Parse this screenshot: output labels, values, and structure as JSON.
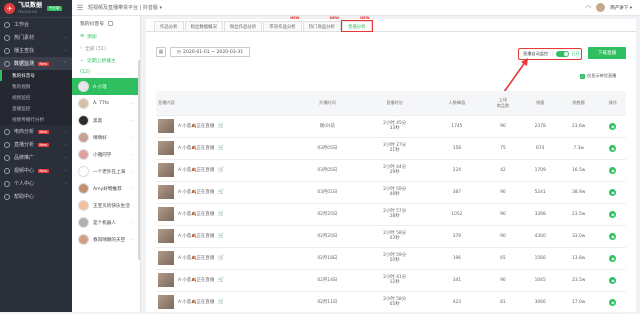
{
  "app": {
    "name": "飞瓜数据",
    "subtitle": "FEIGUA.CN",
    "badge": "专业版"
  },
  "sidebar": {
    "items": [
      {
        "label": "工作台",
        "icon": "home-icon"
      },
      {
        "label": "热门素材",
        "icon": "fire-icon",
        "arrow": "›"
      },
      {
        "label": "播主查找",
        "icon": "user-search-icon",
        "arrow": "›"
      },
      {
        "label": "数据监测",
        "icon": "monitor-icon",
        "arrow": "⌃",
        "badge": "New",
        "active": true
      },
      {
        "label": "电商分析",
        "icon": "cart-icon",
        "arrow": "›",
        "badge": "New"
      },
      {
        "label": "直播分析",
        "icon": "live-icon",
        "arrow": "›",
        "badge": "New"
      },
      {
        "label": "品牌推广",
        "icon": "brand-icon",
        "arrow": "›"
      },
      {
        "label": "视频中心",
        "icon": "video-icon",
        "arrow": "›",
        "badge": "New"
      },
      {
        "label": "个人中心",
        "icon": "person-icon",
        "arrow": "›"
      },
      {
        "label": "帮助中心",
        "icon": "help-icon"
      }
    ],
    "subitems": [
      {
        "label": "我的抖音号",
        "active": true
      },
      {
        "label": "我的视频"
      },
      {
        "label": "视频监控"
      },
      {
        "label": "直播监控"
      },
      {
        "label": "视频传播行分析"
      }
    ]
  },
  "topbar": {
    "crumb": "短视频及直播带货平台  |  抖音版 ▾",
    "collapse": "☰"
  },
  "list_panel": {
    "title": "我的抖音号",
    "add": "添加",
    "all": "全部 (31)",
    "group": "近期上新播主",
    "count": "(12)",
    "accounts": [
      {
        "name": "A·小莲",
        "color": "#e6e6e6",
        "active": true
      },
      {
        "name": "A. 77ts",
        "color": "#d8c0a8"
      },
      {
        "name": "黑黑",
        "color": "#2b2b2b"
      },
      {
        "name": "晴晴好",
        "color": "#c8a090"
      },
      {
        "name": "小雅同学",
        "color": "#e0a0a0"
      },
      {
        "name": "一个老外在上海",
        "color": "#ffffff"
      },
      {
        "name": "Amy好物推荐",
        "color": "#c09070"
      },
      {
        "name": "王宝贝的快乐生活",
        "color": "#f0c0a0"
      },
      {
        "name": "是个机器人",
        "color": "#b0b0b0"
      },
      {
        "name": "春风晴朗的天空",
        "color": "#d0a080"
      }
    ]
  },
  "tabs": [
    {
      "label": "作品分析"
    },
    {
      "label": "粉丝数据概况"
    },
    {
      "label": "粉丝作品分析"
    },
    {
      "label": "带货作品分析",
      "new": "NEW"
    },
    {
      "label": "热门商品分析",
      "new": "NEW"
    },
    {
      "label": "直播分析",
      "new": "NEW",
      "active": true
    }
  ],
  "filters": {
    "date_range": "2020-01-01 ~ 2020-03-31"
  },
  "toggle": {
    "label": "直播自动监控",
    "state": "已开"
  },
  "download_label": "下载直播",
  "only_show": "仅显示带货直播",
  "table": {
    "headers": [
      "直播内容",
      "开播时间",
      "直播时长",
      "人数峰值",
      "上场\n商品数",
      "销量",
      "销售额",
      "操作"
    ],
    "rows": [
      {
        "title": "A·小莲🍂正在直播",
        "start": "刚(0)前",
        "dur": [
          "2小时 45分",
          "33秒"
        ],
        "peak": "1745",
        "items": "90",
        "sales": "2378",
        "revenue": "23.6w"
      },
      {
        "title": "A·小莲🍂正在直播",
        "start": "03月05日",
        "dur": [
          "2小时 27分",
          "21秒"
        ],
        "peak": "158",
        "items": "75",
        "sales": "674",
        "revenue": "7.3w"
      },
      {
        "title": "A·小莲🍂正在直播",
        "start": "03月05日",
        "dur": [
          "2小时 44分",
          "29秒"
        ],
        "peak": "224",
        "items": "42",
        "sales": "1709",
        "revenue": "16.5w"
      },
      {
        "title": "A·小莲🍂正在直播",
        "start": "03月01日",
        "dur": [
          "2小时 59分",
          "48秒"
        ],
        "peak": "387",
        "items": "90",
        "sales": "5241",
        "revenue": "38.9w"
      },
      {
        "title": "A·小莲🍂正在直播",
        "start": "02月25日",
        "dur": [
          "2小时 57分",
          "28秒"
        ],
        "peak": "1052",
        "items": "90",
        "sales": "3398",
        "revenue": "23.5w"
      },
      {
        "title": "A·小莲🍂正在直播",
        "start": "02月20日",
        "dur": [
          "2小时 58分",
          "03秒"
        ],
        "peak": "379",
        "items": "90",
        "sales": "4300",
        "revenue": "33.0w"
      },
      {
        "title": "A·小莲🍂正在直播",
        "start": "02月18日",
        "dur": [
          "2小时 59分",
          "50秒"
        ],
        "peak": "196",
        "items": "65",
        "sales": "1566",
        "revenue": "13.8w"
      },
      {
        "title": "A·小莲🍂正在直播",
        "start": "02月14日",
        "dur": [
          "2小时 41分",
          "12秒"
        ],
        "peak": "341",
        "items": "90",
        "sales": "1045",
        "revenue": "23.5w"
      },
      {
        "title": "A·小莲🍂正在直播",
        "start": "02月11日",
        "dur": [
          "2小时 58分",
          "05秒"
        ],
        "peak": "423",
        "items": "81",
        "sales": "3066",
        "revenue": "17.0w"
      }
    ]
  },
  "colors": {
    "accent": "#2fbf60",
    "highlight": "#e53935",
    "sidebar_bg": "#2b2f3a"
  }
}
